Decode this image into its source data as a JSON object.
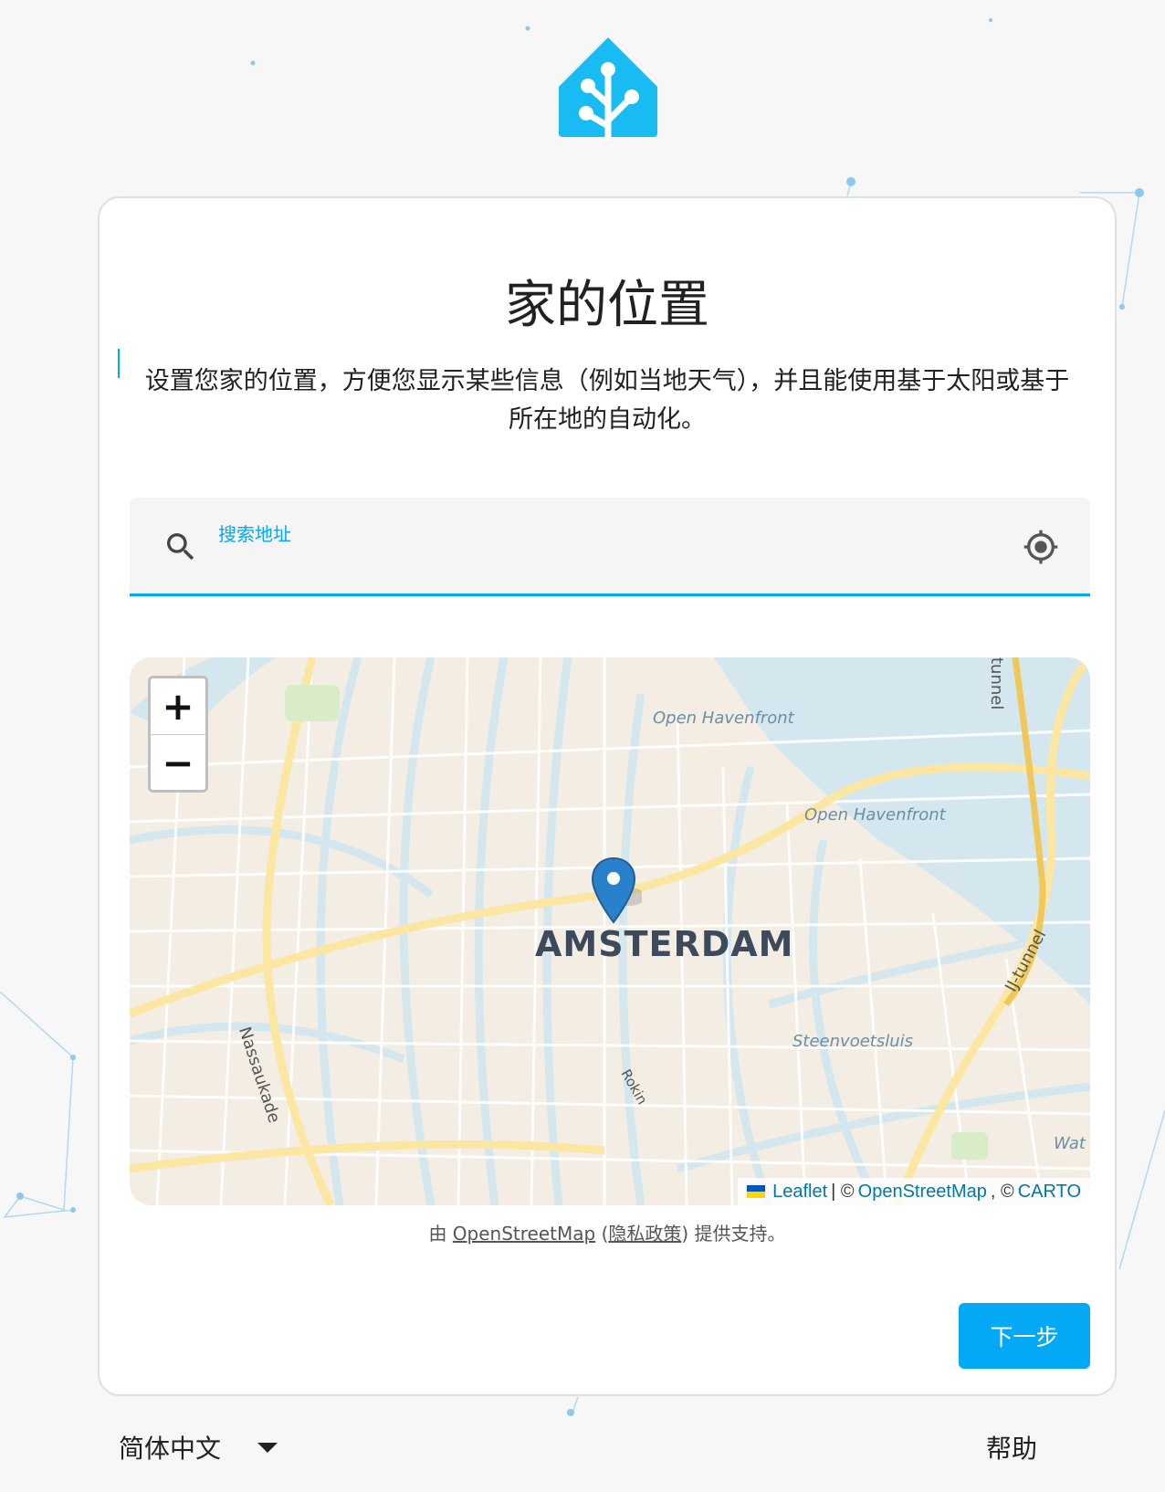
{
  "page": {
    "title": "家的位置",
    "description": "设置您家的位置，方便您显示某些信息（例如当地天气），并且能使用基于太阳或基于所在地的自动化。"
  },
  "search": {
    "label": "搜索地址",
    "value": "",
    "placeholder": ""
  },
  "map": {
    "city_label": "AMSTERDAM",
    "water_labels": [
      "Open Havenfront",
      "Open Havenfront",
      "Steenvoetsluis",
      "Wat"
    ],
    "street_labels": [
      "Nassaukade",
      "IJ-tunnel",
      "tunnel",
      "Rokin"
    ],
    "zoom_in": "+",
    "zoom_out": "−",
    "attribution": {
      "leaflet": "Leaflet",
      "sep": "| ©",
      "osm": "OpenStreetMap",
      "carto_sep": ", ©",
      "carto": "CARTO"
    }
  },
  "powered_by": {
    "prefix": "由",
    "osm": "OpenStreetMap",
    "open_paren": "(",
    "privacy": "隐私政策",
    "close_paren": ")",
    "suffix": "提供支持。"
  },
  "actions": {
    "next": "下一步"
  },
  "footer": {
    "language": "简体中文",
    "help": "帮助"
  },
  "colors": {
    "accent": "#03a9f4",
    "pin": "#2a81cb"
  }
}
